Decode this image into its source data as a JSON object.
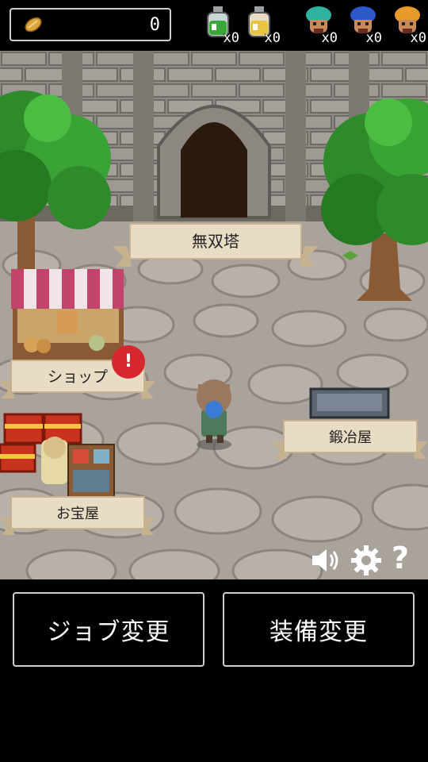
{
  "hud": {
    "coins": "0",
    "items": [
      {
        "name": "green-potion",
        "count": "x0",
        "color": "#3aa838"
      },
      {
        "name": "yellow-potion",
        "count": "x0",
        "color": "#e8c441"
      },
      {
        "name": "teal-hair-hero",
        "count": "x0",
        "color": "#2fb3a0"
      },
      {
        "name": "blue-hair-hero",
        "count": "x0",
        "color": "#2d58c8"
      },
      {
        "name": "orange-hair-hero",
        "count": "x0",
        "color": "#e89a2a"
      }
    ]
  },
  "scene": {
    "tower_label": "無双塔",
    "shop_label": "ショップ",
    "shop_alert": "!",
    "blacksmith_label": "鍛冶屋",
    "treasure_label": "お宝屋"
  },
  "controls": {
    "sound_icon": "speaker-icon",
    "settings_icon": "gear-icon",
    "help_icon": "?"
  },
  "buttons": {
    "job_change": "ジョブ変更",
    "equipment_change": "装備変更"
  }
}
